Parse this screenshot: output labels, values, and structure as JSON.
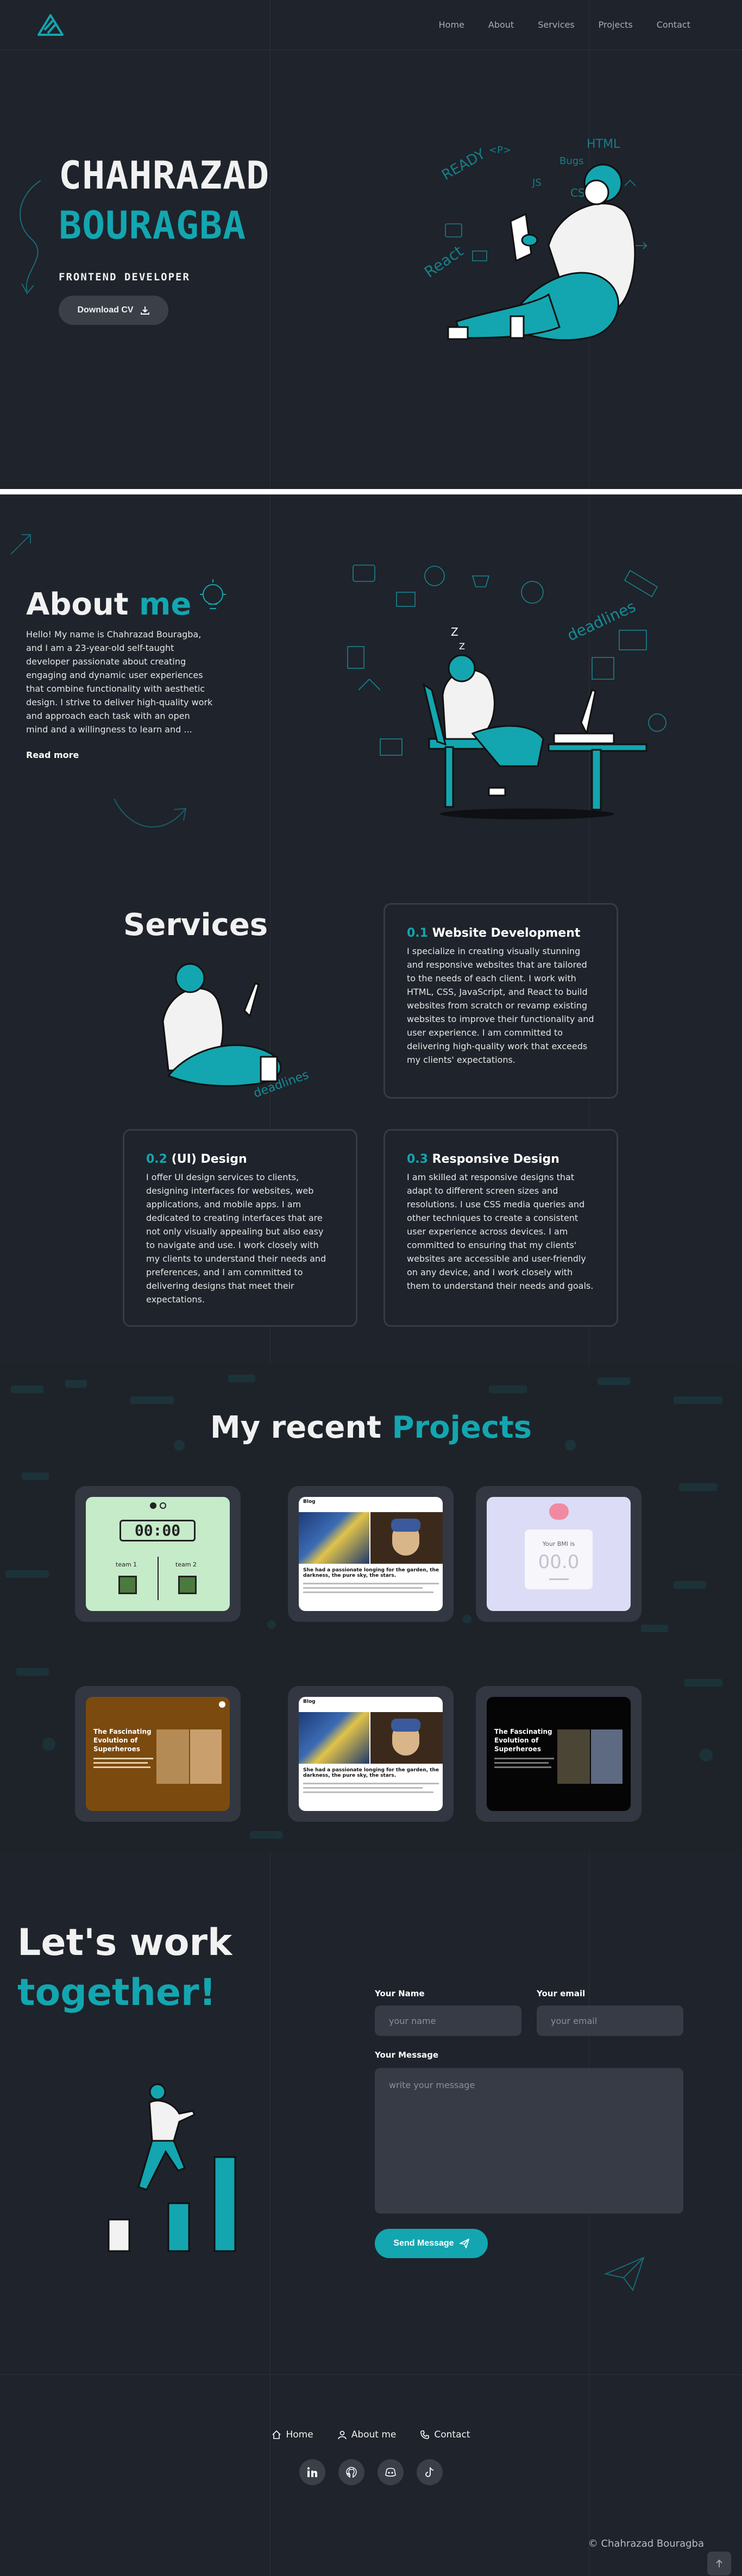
{
  "nav": {
    "logo_icon": "stacked-triangle-logo",
    "links": [
      "Home",
      "About",
      "Services",
      "Projects",
      "Contact"
    ]
  },
  "hero": {
    "first_name": "CHAHRAZAD",
    "last_name": "BOURAGBA",
    "role": "FRONTEND DEVELOPER",
    "cv_button": "Download CV",
    "cv_icon": "download-icon",
    "doodles": [
      "READY",
      "HTML",
      "CSS",
      "<P>",
      "JS",
      "React",
      "Bugs"
    ]
  },
  "about": {
    "title_1": "About",
    "title_2": "me",
    "text": "Hello! My name is Chahrazad Bouragba, and I am a 23-year-old self-taught developer passionate about creating engaging and dynamic user experiences that combine functionality with aesthetic design. I strive to deliver high-quality work and approach each task with an open mind and a willingness to learn and ...",
    "read_more": "Read more",
    "doodles": [
      "deadlines",
      "Z",
      "Z"
    ]
  },
  "services": {
    "title": "Services",
    "doodle": "deadlines",
    "cards": [
      {
        "num": "0.1",
        "title": "Website Development",
        "text": "I specialize in creating visually stunning and responsive websites that are tailored to the needs of each client. I work with HTML, CSS, JavaScript, and React to build websites from scratch or revamp existing websites to improve their functionality and user experience. I am committed to delivering high-quality work that exceeds my clients' expectations."
      },
      {
        "num": "0.2",
        "title": "(UI) Design",
        "text": "I offer UI design services to clients, designing interfaces for websites, web applications, and mobile apps. I am dedicated to creating interfaces that are not only visually appealing but also easy to navigate and use. I work closely with my clients to understand their needs and preferences, and I am committed to delivering designs that meet their expectations."
      },
      {
        "num": "0.3",
        "title": "Responsive Design",
        "text": "I am skilled at responsive designs that adapt to different screen sizes and resolutions. I use CSS media queries and other techniques to create a consistent user experience across devices. I am committed to ensuring that my clients' websites are accessible and user-friendly on any device, and I work closely with them to understand their needs and goals."
      }
    ]
  },
  "projects": {
    "title_1": "My recent",
    "title_2": "Projects",
    "timer": {
      "display": "00:00",
      "team1": "team 1",
      "team2": "team 2"
    },
    "bmi": {
      "label": "Your BMI is",
      "value": "00.0"
    },
    "blog": {
      "brand": "Blog",
      "headline": "She had a passionate longing for the garden, the darkness, the pure sky, the stars."
    },
    "superheroes": {
      "title": "The Fascinating Evolution of Superheroes"
    }
  },
  "contact": {
    "title_1": "Let's work",
    "title_2": "together!",
    "name_label": "Your Name",
    "name_placeholder": "your name",
    "email_label": "Your email",
    "email_placeholder": "your email",
    "message_label": "Your Message",
    "message_placeholder": "write your message",
    "send_button": "Send Message",
    "send_icon": "paper-plane-icon"
  },
  "footer": {
    "links": [
      {
        "label": "Home",
        "icon": "home-icon"
      },
      {
        "label": "About me",
        "icon": "user-icon"
      },
      {
        "label": "Contact",
        "icon": "phone-icon"
      }
    ],
    "socials": [
      "linkedin-icon",
      "github-icon",
      "discord-icon",
      "tiktok-icon"
    ],
    "copyright": "© Chahrazad Bouragba",
    "to_top_icon": "arrow-up-icon"
  },
  "colors": {
    "accent": "#13a6b0",
    "background": "#1f232b",
    "card_border": "#363b44"
  }
}
